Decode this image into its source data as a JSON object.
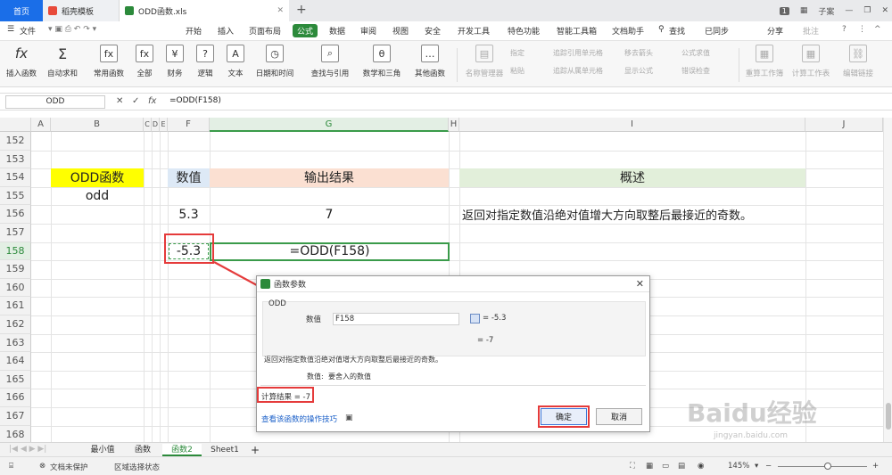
{
  "titlebar": {
    "home": "首页",
    "tab1": "稻壳模板",
    "tab2": "ODD函数.xls",
    "right_badge": "1",
    "user": "子案"
  },
  "menubar": {
    "file": "文件",
    "items": [
      "开始",
      "插入",
      "页面布局",
      "公式",
      "数据",
      "审阅",
      "视图",
      "安全",
      "开发工具",
      "特色功能",
      "智能工具箱",
      "文档助手",
      "查找"
    ],
    "active": "公式",
    "sync": "已同步",
    "share": "分享",
    "annotate": "批注"
  },
  "ribbon": {
    "buttons": [
      "插入函数",
      "自动求和",
      "常用函数",
      "全部",
      "财务",
      "逻辑",
      "文本",
      "日期和时间",
      "查找与引用",
      "数学和三角",
      "其他函数",
      "名称管理器",
      "重算工作簿",
      "计算工作表",
      "编辑链接"
    ],
    "small": [
      "指定",
      "粘贴",
      "追踪引用单元格",
      "移去箭头",
      "公式求值",
      "追踪从属单元格",
      "显示公式",
      "错误检查"
    ]
  },
  "formula_bar": {
    "name_box": "ODD",
    "formula": "=ODD(F158)"
  },
  "grid": {
    "columns": [
      "A",
      "B",
      "C",
      "D",
      "E",
      "F",
      "G",
      "H",
      "I",
      "J"
    ],
    "rows": [
      "152",
      "153",
      "154",
      "155",
      "156",
      "157",
      "158",
      "159",
      "160",
      "161",
      "162",
      "163",
      "164",
      "165",
      "166",
      "167",
      "168"
    ],
    "cells": {
      "b154": "ODD函数",
      "b155": "odd",
      "f154": "数值",
      "g154": "输出结果",
      "i154": "概述",
      "f156": "5.3",
      "g156": "7",
      "i156": "返回对指定数值沿绝对值增大方向取整后最接近的奇数。",
      "f158": "-5.3",
      "g158": "=ODD(F158)"
    },
    "colors": {
      "yellow": "#ffff00",
      "blue": "#dde9f6",
      "peach": "#fbe0d2",
      "green": "#e2efda"
    }
  },
  "dialog": {
    "title": "函数参数",
    "func_name": "ODD",
    "param_label": "数值",
    "param_value": "F158",
    "param_result": "= -5.3",
    "total_result": "= -7",
    "description": "返回对指定数值沿绝对值增大方向取整后最接近的奇数。",
    "param_desc_label": "数值:",
    "param_desc": "要舍入的数值",
    "calc_result": "计算结果 = -7",
    "help_link": "查看该函数的操作技巧",
    "ok": "确定",
    "cancel": "取消"
  },
  "sheets": {
    "tabs": [
      "最小值",
      "函数",
      "函数2",
      "Sheet1"
    ],
    "active": "函数2"
  },
  "statusbar": {
    "protect": "文档未保护",
    "region": "区域选择状态",
    "zoom": "145%"
  },
  "watermark": {
    "main": "Baidu经验",
    "url": "jingyan.baidu.com"
  }
}
